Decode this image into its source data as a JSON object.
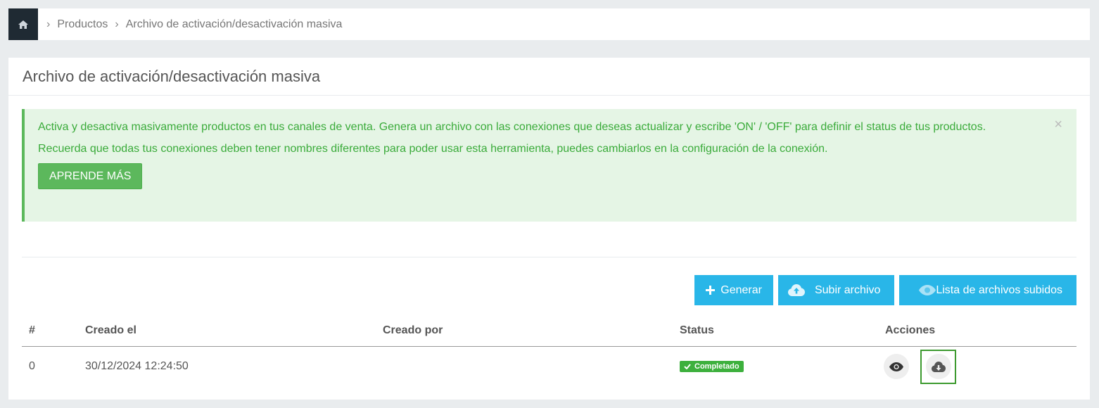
{
  "breadcrumb": {
    "items": [
      "Productos",
      "Archivo de activación/desactivación masiva"
    ]
  },
  "page": {
    "title": "Archivo de activación/desactivación masiva"
  },
  "alert": {
    "line1": "Activa y desactiva masivamente productos en tus canales de venta. Genera un archivo con las conexiones que deseas actualizar y escribe 'ON' / 'OFF' para definir el status de tus productos.",
    "line2": "Recuerda que todas tus conexiones deben tener nombres diferentes para poder usar esta herramienta, puedes cambiarlos en la configuración de la conexión.",
    "button": "APRENDE MÁS",
    "close": "×"
  },
  "actions": {
    "generate": "Generar",
    "upload": "Subir archivo",
    "list": "Lista de archivos subidos"
  },
  "table": {
    "headers": [
      "#",
      "Creado el",
      "Creado por",
      "Status",
      "Acciones"
    ],
    "rows": [
      {
        "index": "0",
        "created_at": "30/12/2024 12:24:50",
        "created_by": "",
        "status": "Completado"
      }
    ]
  },
  "colors": {
    "info": "#29b6e8",
    "success": "#5cb85c",
    "dark": "#1f2a33"
  }
}
